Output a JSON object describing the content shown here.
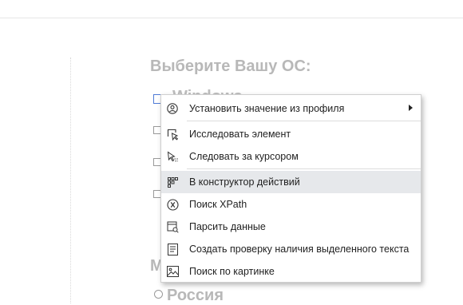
{
  "page": {
    "heading": "Выберите Вашу ОС:",
    "first_option_partial": "Windows",
    "bottom_heading_partial": "М",
    "radio_label": "Россия"
  },
  "context_menu": {
    "items": [
      {
        "label": "Установить значение из профиля",
        "icon": "profile-icon",
        "submenu": true
      },
      {
        "label": "Исследовать элемент",
        "icon": "inspect-element-icon"
      },
      {
        "label": "Следовать за курсором",
        "icon": "follow-cursor-icon"
      },
      {
        "label": "В конструктор действий",
        "icon": "action-builder-icon",
        "highlighted": true
      },
      {
        "label": "Поиск XPath",
        "icon": "xpath-icon"
      },
      {
        "label": "Парсить данные",
        "icon": "parse-data-icon"
      },
      {
        "label": "Создать проверку наличия выделенного текста",
        "icon": "text-check-icon"
      },
      {
        "label": "Поиск по картинке",
        "icon": "image-search-icon"
      }
    ]
  }
}
